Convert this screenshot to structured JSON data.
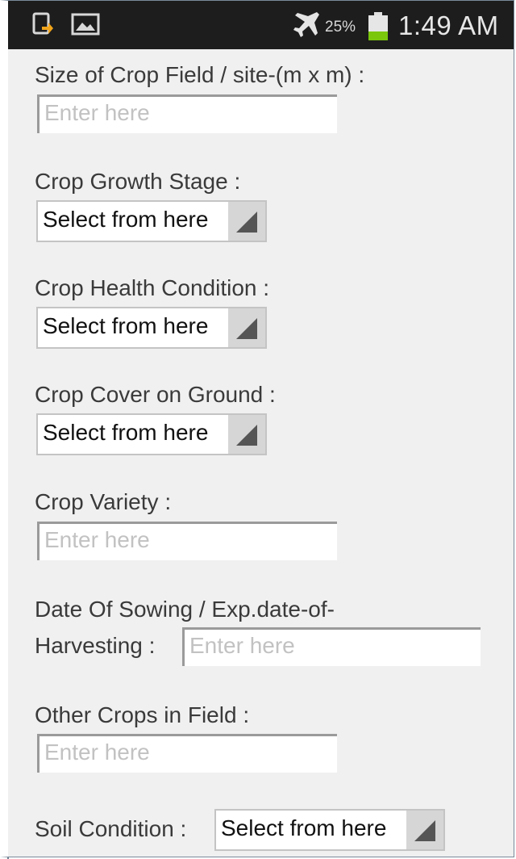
{
  "status_bar": {
    "battery_percent": "25%",
    "time": "1:49 AM",
    "icons": [
      "download-app-icon",
      "image-icon",
      "airplane-mode-icon",
      "battery-icon"
    ]
  },
  "form": {
    "crop_field_size": {
      "label": "Size of Crop Field / site-(m x m) :",
      "placeholder": "Enter here"
    },
    "crop_growth_stage": {
      "label": "Crop Growth Stage :",
      "selected": "Select from here"
    },
    "crop_health_condition": {
      "label": "Crop Health Condition :",
      "selected": "Select from here"
    },
    "crop_cover_on_ground": {
      "label": "Crop Cover on Ground :",
      "selected": "Select from here"
    },
    "crop_variety": {
      "label": "Crop Variety :",
      "placeholder": "Enter here"
    },
    "date_of_sowing": {
      "label_line1": "Date Of Sowing / Exp.date-of-",
      "label_line2": "Harvesting :",
      "placeholder": "Enter here"
    },
    "other_crops": {
      "label": "Other Crops in Field :",
      "placeholder": "Enter here"
    },
    "soil_condition": {
      "label": "Soil Condition :",
      "selected": "Select from here"
    }
  },
  "colors": {
    "status_bar": "#1d1d1d",
    "background": "#f0f0f0",
    "battery_level": "#7ac70c"
  }
}
